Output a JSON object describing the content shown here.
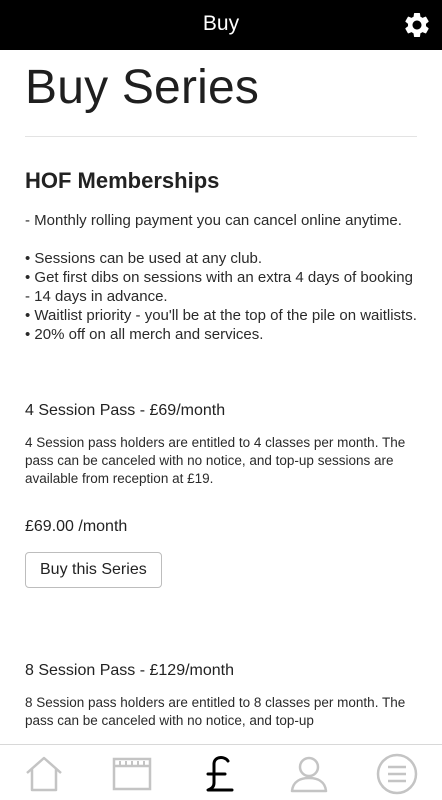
{
  "header": {
    "title": "Buy"
  },
  "page": {
    "title": "Buy Series"
  },
  "membership": {
    "heading": "HOF Memberships",
    "description": "- Monthly rolling payment you can cancel online anytime.\n\n• Sessions can be used at any club.\n• Get first dibs on sessions with an extra 4 days of booking - 14 days in advance.\n• Waitlist priority - you'll be at the top of the pile on waitlists.\n• 20% off on all merch and services."
  },
  "passes": [
    {
      "title": "4 Session Pass - £69/month",
      "description": "4 Session pass holders are entitled to 4 classes per month. The pass can be canceled with no notice, and top-up sessions are available from reception at £19.",
      "price": "£69.00 /month",
      "button_label": "Buy this Series"
    },
    {
      "title": "8 Session Pass - £129/month",
      "description": "8 Session pass holders are entitled to 8 classes per month. The pass can be canceled with no notice, and top-up"
    }
  ],
  "bottom_nav": {
    "items": [
      {
        "icon": "home-icon"
      },
      {
        "icon": "calendar-icon"
      },
      {
        "icon": "pound-icon",
        "active": true
      },
      {
        "icon": "user-icon"
      },
      {
        "icon": "menu-icon"
      }
    ]
  },
  "colors": {
    "topbar": "#000000",
    "icon_gray": "#c4c4c4",
    "active_icon": "#000000"
  }
}
